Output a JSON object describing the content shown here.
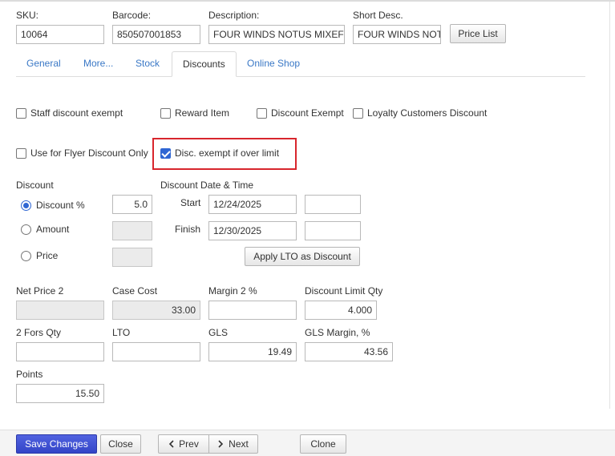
{
  "header": {
    "sku_label": "SKU:",
    "sku_value": "10064",
    "barcode_label": "Barcode:",
    "barcode_value": "850507001853",
    "description_label": "Description:",
    "description_value": "FOUR WINDS NOTUS MIXEF",
    "short_desc_label": "Short Desc.",
    "short_desc_value": "FOUR WINDS NOT",
    "price_list_button": "Price List"
  },
  "tabs": [
    {
      "label": "General",
      "active": false
    },
    {
      "label": "More...",
      "active": false
    },
    {
      "label": "Stock",
      "active": false
    },
    {
      "label": "Discounts",
      "active": true
    },
    {
      "label": "Online Shop",
      "active": false
    }
  ],
  "checkboxes": {
    "staff_discount_exempt": {
      "label": "Staff discount exempt",
      "checked": false
    },
    "reward_item": {
      "label": "Reward Item",
      "checked": false
    },
    "discount_exempt": {
      "label": "Discount Exempt",
      "checked": false
    },
    "loyalty_customers_discount": {
      "label": "Loyalty Customers Discount",
      "checked": false
    },
    "use_for_flyer_discount_only": {
      "label": "Use for Flyer Discount Only",
      "checked": false
    },
    "disc_exempt_if_over_limit": {
      "label": "Disc. exempt if over limit",
      "checked": true
    }
  },
  "discount": {
    "section_label": "Discount",
    "options": [
      {
        "label": "Discount %",
        "selected": true,
        "value": "5.0"
      },
      {
        "label": "Amount",
        "selected": false,
        "value": ""
      },
      {
        "label": "Price",
        "selected": false,
        "value": ""
      }
    ]
  },
  "discount_date": {
    "section_label": "Discount Date & Time",
    "start_label": "Start",
    "start_date": "12/24/2025",
    "start_time": "",
    "finish_label": "Finish",
    "finish_date": "12/30/2025",
    "finish_time": "",
    "apply_lto_button": "Apply LTO as Discount"
  },
  "pricing": {
    "net_price_2_label": "Net Price 2",
    "net_price_2_value": "",
    "case_cost_label": "Case Cost",
    "case_cost_value": "33.00",
    "margin_2_label": "Margin 2 %",
    "margin_2_value": "",
    "discount_limit_qty_label": "Discount Limit Qty",
    "discount_limit_qty_value": "4.000",
    "two_fors_qty_label": "2 Fors Qty",
    "two_fors_qty_value": "",
    "lto_label": "LTO",
    "lto_value": "",
    "gls_label": "GLS",
    "gls_value": "19.49",
    "gls_margin_label": "GLS Margin, %",
    "gls_margin_value": "43.56",
    "points_label": "Points",
    "points_value": "15.50"
  },
  "footer": {
    "save_changes": "Save Changes",
    "close": "Close",
    "prev": "Prev",
    "next": "Next",
    "clone": "Clone"
  },
  "colors": {
    "accent": "#3344c7",
    "tab_link": "#3a78c6",
    "checkbox_checked": "#2f66d3",
    "highlight_border": "#d8262d"
  }
}
